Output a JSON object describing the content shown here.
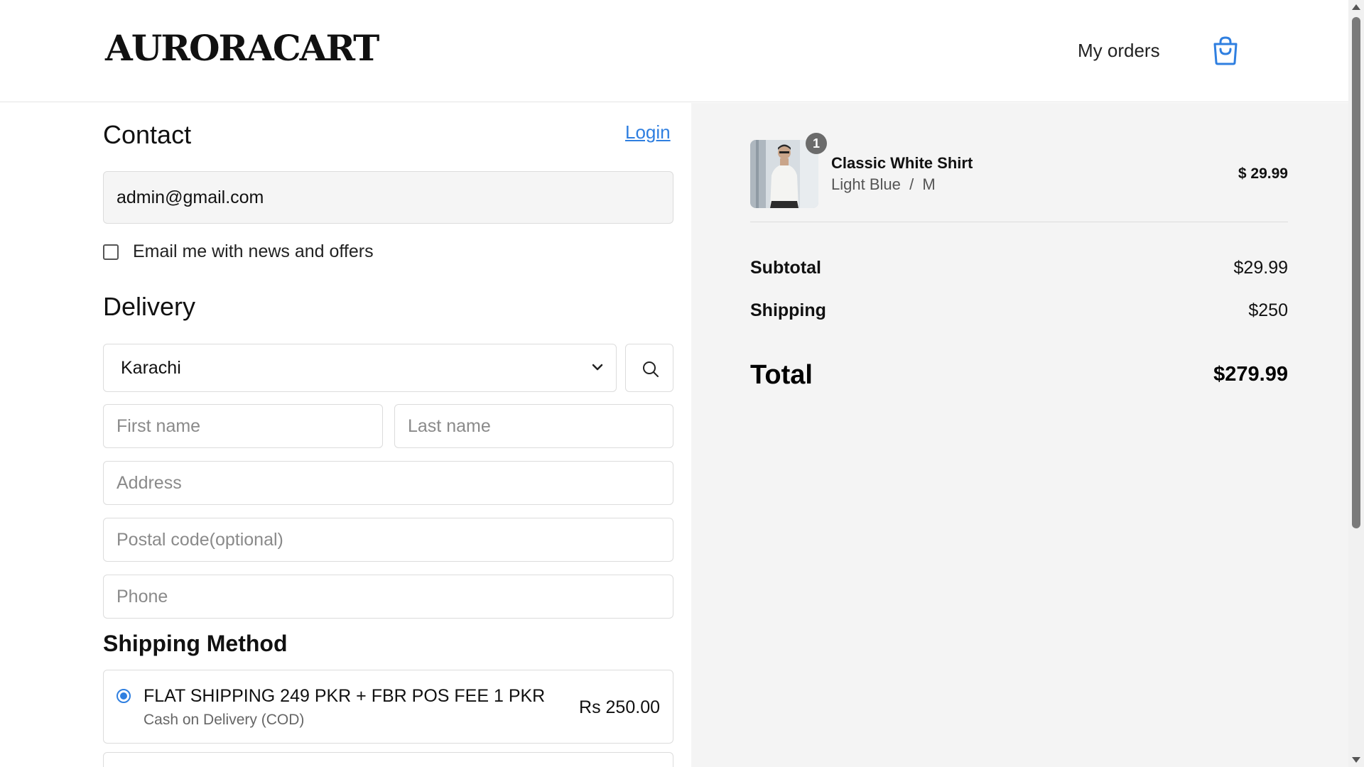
{
  "header": {
    "logo": "AURORACART",
    "my_orders": "My orders",
    "cart_icon": "shopping-bag-icon"
  },
  "contact": {
    "title": "Contact",
    "login_label": "Login",
    "email_value": "admin@gmail.com",
    "newsletter_label": "Email me with news and offers",
    "newsletter_checked": false
  },
  "delivery": {
    "title": "Delivery",
    "city_selected": "Karachi",
    "search_icon": "search-icon",
    "first_name_placeholder": "First name",
    "last_name_placeholder": "Last name",
    "address_placeholder": "Address",
    "postal_placeholder": "Postal code(optional)",
    "phone_placeholder": "Phone"
  },
  "shipping_method": {
    "title": "Shipping Method",
    "options": [
      {
        "name": "FLAT SHIPPING 249 PKR + FBR POS FEE 1 PKR",
        "subtitle": "Cash on Delivery (COD)",
        "price": "Rs 250.00",
        "selected": true
      }
    ]
  },
  "summary": {
    "items": [
      {
        "name": "Classic White Shirt",
        "variant": "Light Blue  /  M",
        "price": "$ 29.99",
        "quantity": "1"
      }
    ],
    "subtotal_label": "Subtotal",
    "subtotal_value": "$29.99",
    "shipping_label": "Shipping",
    "shipping_value": "$250",
    "total_label": "Total",
    "total_value": "$279.99"
  },
  "colors": {
    "accent": "#2f7fe0",
    "summary_bg": "#f4f4f4",
    "border": "#dcdcdc"
  }
}
